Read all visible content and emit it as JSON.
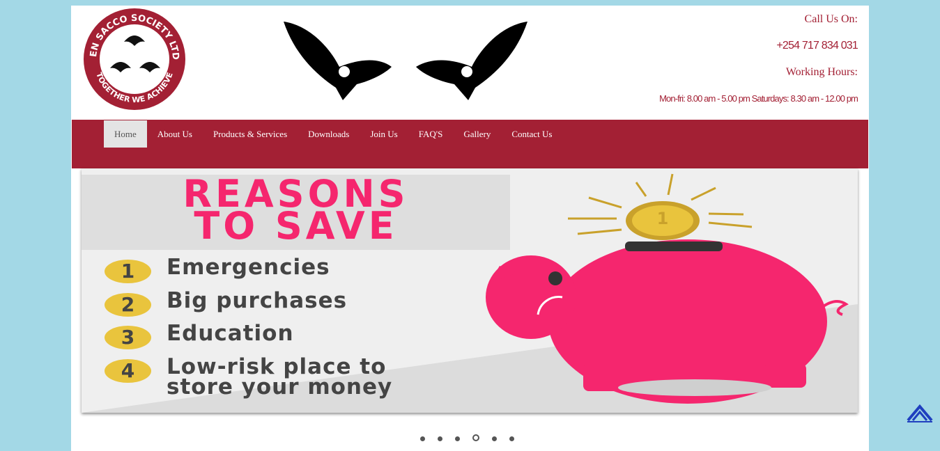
{
  "logo": {
    "ring_text_top": "FEN SACCO SOCIETY LTD.",
    "ring_text_bottom": "TOGETHER WE ACHIEVE",
    "colors": {
      "ring": "#a32034",
      "text": "#ffffff"
    }
  },
  "header": {
    "call_label": "Call Us On:",
    "phone": "+254 717 834 031",
    "hours_label": "Working Hours:",
    "hours": "Mon-fri: 8.00 am - 5.00 pm Saturdays: 8.30 am - 12.00 pm"
  },
  "nav": {
    "items": [
      {
        "label": "Home",
        "active": true
      },
      {
        "label": "About Us"
      },
      {
        "label": "Products & Services"
      },
      {
        "label": "Downloads"
      },
      {
        "label": "Join Us"
      },
      {
        "label": "FAQ'S"
      },
      {
        "label": "Gallery"
      },
      {
        "label": "Contact Us"
      }
    ]
  },
  "banner": {
    "headline_line1": "REASONS",
    "headline_line2": "TO SAVE",
    "reasons": [
      {
        "num": "1",
        "text": "Emergencies"
      },
      {
        "num": "2",
        "text": "Big purchases"
      },
      {
        "num": "3",
        "text": "Education"
      },
      {
        "num": "4",
        "text": "Low-risk place to",
        "text2": "store your money"
      }
    ],
    "coin_label": "1",
    "colors": {
      "pink": "#f5266e",
      "gold": "#e9c43d",
      "text": "#444444"
    }
  },
  "slider": {
    "count": 6,
    "active_index": 3
  },
  "colors": {
    "brand": "#a32034",
    "background": "#a3d8e6",
    "nav_active": "#e4e4e4"
  },
  "icons": {
    "back_to_top": "chevron-up-icon"
  }
}
